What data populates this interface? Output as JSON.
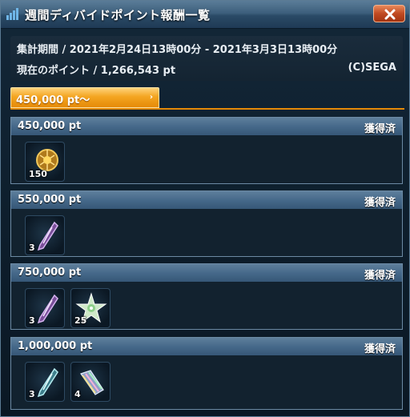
{
  "window": {
    "title": "週間ディバイドポイント報酬一覧"
  },
  "info": {
    "period_line": "集計期間 / 2021年2月24日13時00分 - 2021年3月3日13時00分",
    "points_line": "現在のポイント / 1,266,543 pt",
    "copyright": "(C)SEGA"
  },
  "tab": {
    "label": "450,000 pt〜",
    "arrow": "›"
  },
  "tiers": [
    {
      "points": "450,000 pt",
      "status": "獲得済",
      "items": [
        {
          "icon": "gold-orb-icon",
          "qty": "150"
        }
      ]
    },
    {
      "points": "550,000 pt",
      "status": "獲得済",
      "items": [
        {
          "icon": "purple-crystal-shard-icon",
          "qty": "3"
        }
      ]
    },
    {
      "points": "750,000 pt",
      "status": "獲得済",
      "items": [
        {
          "icon": "purple-crystal-shard-icon",
          "qty": "3"
        },
        {
          "icon": "star-crystal-icon",
          "qty": "25"
        }
      ]
    },
    {
      "points": "1,000,000 pt",
      "status": "獲得済",
      "items": [
        {
          "icon": "teal-crystal-shard-icon",
          "qty": "3"
        },
        {
          "icon": "rainbow-fragment-icon",
          "qty": "4"
        }
      ]
    }
  ]
}
